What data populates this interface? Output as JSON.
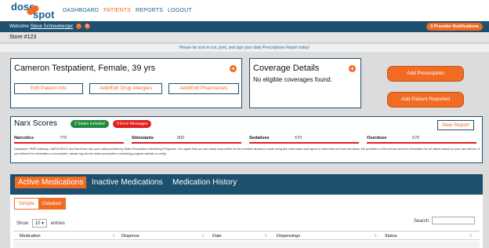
{
  "logo": {
    "part1": "dose",
    "part2": "spot"
  },
  "nav": [
    "DASHBOARD",
    "PATIENTS",
    "REPORTS",
    "LOGOUT"
  ],
  "welcome": {
    "prefix": "Welcome",
    "user": "Steve Schneeberger",
    "notifications": "0 Provider Notifications"
  },
  "store": "Store #123",
  "notice": "Please be sure to run, print, and sign your daily Prescriptions Report today!",
  "patient": {
    "title": "Cameron Testpatient, Female, 39 yrs",
    "buttons": [
      "Edit Patient Info",
      "Add/Edit Drug Allergies",
      "Add/Edit Pharmacies"
    ]
  },
  "coverage": {
    "title": "Coverage Details",
    "text": "No eligible coverages found."
  },
  "actions": {
    "add_prescription": "Add Prescription",
    "add_patient_reported": "Add Patient Reported"
  },
  "narx": {
    "title": "Narx Scores",
    "badge_states": "2 States Included",
    "badge_errors": "0 Error Messages",
    "view_report": "View Report",
    "scores": [
      {
        "name": "Narcotics",
        "value": "770"
      },
      {
        "name": "Stimulants",
        "value": "000"
      },
      {
        "name": "Sedatives",
        "value": "570"
      },
      {
        "name": "Overdose",
        "value": "670"
      }
    ],
    "disclaimer": "Disclaimer: PMP Gateway, NARxCHECK and NarxCare rely upon data provided by State Prescription Monitoring Programs. You agree that you are solely responsible for the medical decisions made using this information and agree to indemnify and hold harmless, the providers of this service and the information for all claims based on your use thereof. If you believe the information is incomplete, please log into the state prescription monitoring program website to verify."
  },
  "meds": {
    "tabs": [
      "Active Medications",
      "Inactive Medications",
      "Medication History"
    ],
    "views": [
      "Simple",
      "Detailed"
    ],
    "show_label": "Show",
    "entries_value": "10",
    "entries_label": "entries",
    "search_label": "Search:",
    "columns": [
      "Medication",
      "Dispense",
      "Date",
      "Dispensings",
      "Status"
    ]
  },
  "colors": {
    "brand_navy": "#1d4f6e",
    "accent_orange": "#f26b22",
    "alert_red": "#e01f1f",
    "ok_green": "#1e8a3c"
  }
}
